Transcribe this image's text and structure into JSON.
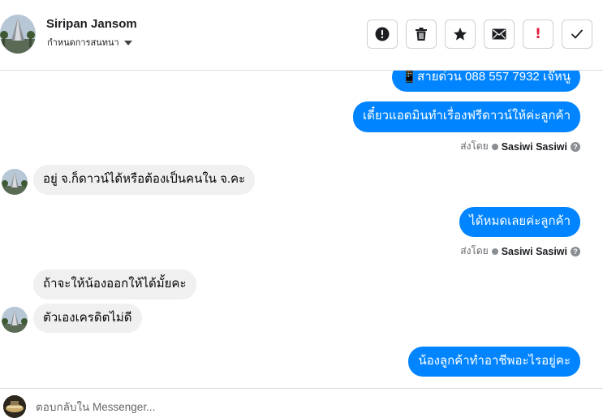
{
  "header": {
    "contact_name": "Siripan Jansom",
    "subtitle": "กำหนดการสนทนา",
    "toolbar": [
      {
        "icon": "exclamation-circle-icon"
      },
      {
        "icon": "trash-icon"
      },
      {
        "icon": "star-icon"
      },
      {
        "icon": "envelope-icon"
      },
      {
        "icon": "red-exclamation-icon"
      },
      {
        "icon": "checkmark-icon"
      }
    ]
  },
  "messages": [
    {
      "dir": "out",
      "text": "📱สายด่วน 088 557 7932 เจ๊หนู"
    },
    {
      "dir": "out",
      "text": "เดี๋ยวแอดมินทำเรื่องฟรีดาวน์ให้ค่ะลูกค้า",
      "sent_by_label": "ส่งโดย",
      "sender": "Sasiwi Sasiwi"
    },
    {
      "dir": "in",
      "text": "อยู่ จ.ก็ดาวน์ได้หรือต้องเป็นคนใน จ.คะ"
    },
    {
      "dir": "out",
      "text": "ได้หมดเลยค่ะลูกค้า",
      "sent_by_label": "ส่งโดย",
      "sender": "Sasiwi Sasiwi"
    },
    {
      "dir": "in",
      "text": "ถ้าจะให้น้องออกให้ได้มั้ยคะ"
    },
    {
      "dir": "in",
      "text": "ตัวเองเครดิตไม่ดี"
    },
    {
      "dir": "out",
      "text": "น้องลูกค้าทำอาชีพอะไรอยู่คะ"
    }
  ],
  "footer": {
    "reply_placeholder": "ตอบกลับใน Messenger..."
  },
  "colors": {
    "outgoing_bubble": "#0084ff",
    "incoming_bubble": "#f0f0f0",
    "alert_red": "#e41e3f"
  }
}
